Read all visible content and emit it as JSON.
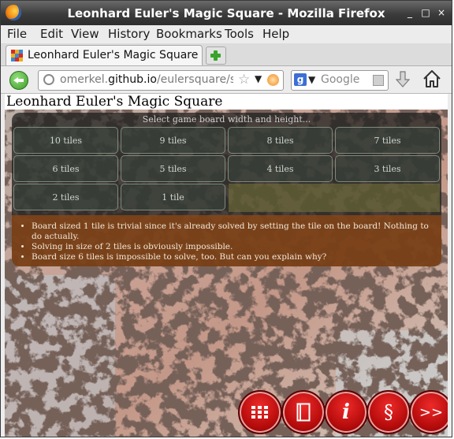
{
  "window": {
    "title": "Leonhard Euler's Magic Square - Mozilla Firefox",
    "controls": [
      "_",
      "□",
      "×"
    ]
  },
  "menu": [
    "File",
    "Edit",
    "View",
    "History",
    "Bookmarks",
    "Tools",
    "Help"
  ],
  "tab": {
    "label": "Leonhard Euler's Magic Square",
    "new_tab": "+"
  },
  "nav": {
    "url_prefix": "omerkel.",
    "url_domain": "github.io",
    "url_suffix": "/eulersquare/src",
    "search_engine": "g",
    "search_placeholder": "Google"
  },
  "page": {
    "heading": "Leonhard Euler's Magic Square",
    "panel_title": "Select game board width and height...",
    "tiles": [
      "10 tiles",
      "9 tiles",
      "8 tiles",
      "7 tiles",
      "6 tiles",
      "5 tiles",
      "4 tiles",
      "3 tiles",
      "2 tiles",
      "1 tile"
    ],
    "notes": [
      "Board sized 1 tile is trivial since it's already solved by setting the tile on the board! Nothing to do actually.",
      "Solving in size of 2 tiles is obviously impossible.",
      "Board size 6 tiles is impossible to solve, too. But can you explain why?"
    ]
  },
  "toolbar": {
    "buttons": [
      {
        "name": "grid-icon",
        "label": ""
      },
      {
        "name": "book-icon",
        "label": ""
      },
      {
        "name": "info-icon",
        "label": "i"
      },
      {
        "name": "section-icon",
        "label": "§"
      },
      {
        "name": "next-icon",
        "label": ">>"
      }
    ]
  },
  "colors": {
    "accent_red": "#c81414",
    "notes_bg": "#8c4614",
    "panel_bg": "#1c1e1c"
  }
}
